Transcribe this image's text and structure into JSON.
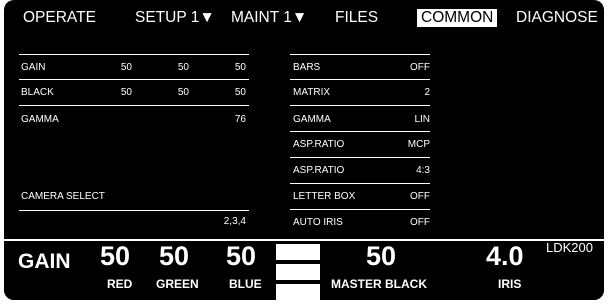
{
  "menu": {
    "operate": "OPERATE",
    "setup": "SETUP 1▼",
    "maint": "MAINT 1▼",
    "files": "FILES",
    "common": "COMMON",
    "diagnose": "DIAGNOSE"
  },
  "left_table": {
    "gain": {
      "label": "GAIN",
      "values": [
        "50",
        "50",
        "50"
      ]
    },
    "black": {
      "label": "BLACK",
      "values": [
        "50",
        "50",
        "50"
      ]
    },
    "gamma": {
      "label": "GAMMA",
      "value": "76"
    },
    "camera_select": {
      "label": "CAMERA SELECT",
      "value": "2,3,4"
    }
  },
  "right_table": [
    {
      "label": "BARS",
      "value": "OFF"
    },
    {
      "label": "MATRIX",
      "value": "2"
    },
    {
      "label": "GAMMA",
      "value": "LIN"
    },
    {
      "label": "ASP.RATIO",
      "value": "MCP"
    },
    {
      "label": "ASP.RATIO",
      "value": "4:3"
    },
    {
      "label": "LETTER BOX",
      "value": "OFF"
    },
    {
      "label": "AUTO IRIS",
      "value": "OFF"
    }
  ],
  "bottom": {
    "gain_label": "GAIN",
    "red_value": "50",
    "red_label": "RED",
    "green_value": "50",
    "green_label": "GREEN",
    "blue_value": "50",
    "blue_label": "BLUE",
    "master_black_value": "50",
    "master_black_label": "MASTER BLACK",
    "iris_value": "4.0",
    "iris_label": "IRIS",
    "model": "LDK200"
  }
}
